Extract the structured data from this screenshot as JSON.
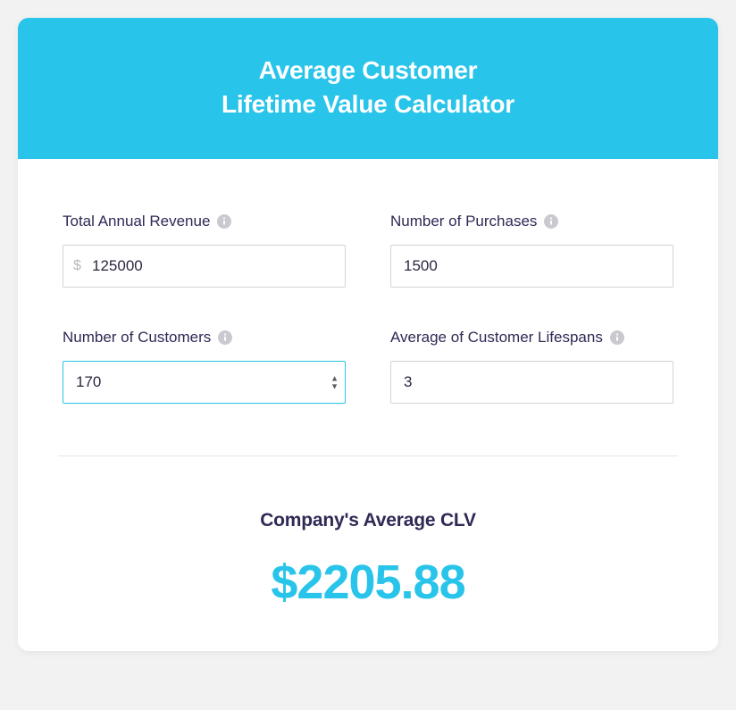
{
  "header": {
    "title_line1": "Average Customer",
    "title_line2": "Lifetime Value Calculator"
  },
  "fields": {
    "revenue": {
      "label": "Total Annual Revenue",
      "prefix": "$",
      "value": "125000"
    },
    "purchases": {
      "label": "Number of Purchases",
      "value": "1500"
    },
    "customers": {
      "label": "Number of Customers",
      "value": "170"
    },
    "lifespan": {
      "label": "Average of Customer Lifespans",
      "value": "3"
    }
  },
  "result": {
    "label": "Company's Average CLV",
    "value": "$2205.88"
  },
  "colors": {
    "accent": "#29c4ea",
    "text_dark": "#2e2a55"
  }
}
